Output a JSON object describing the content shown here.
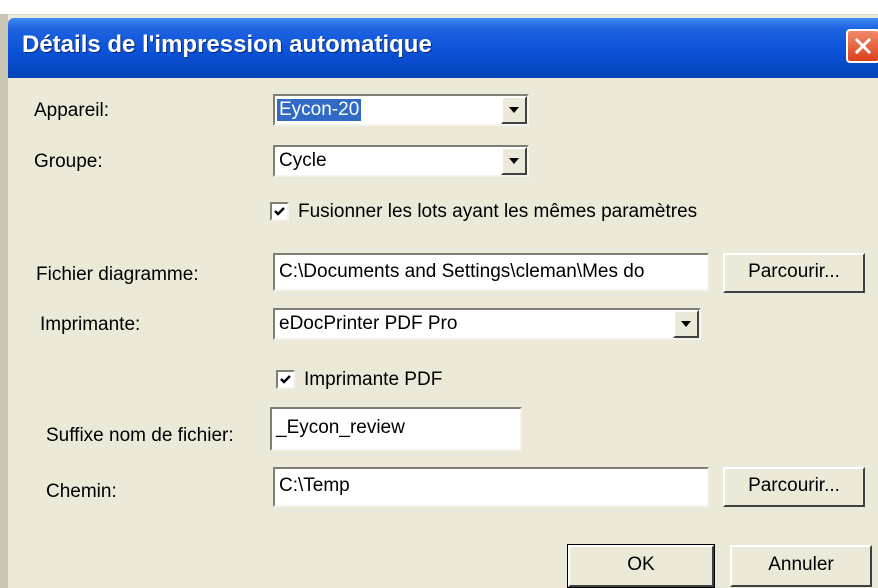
{
  "window": {
    "title": "Détails de l'impression automatique"
  },
  "form": {
    "appareil": {
      "label": "Appareil:",
      "value": "Eycon-20"
    },
    "groupe": {
      "label": "Groupe:",
      "value": "Cycle"
    },
    "fusionner": {
      "label": "Fusionner les lots ayant les mêmes paramètres",
      "checked": true
    },
    "fichier_diagramme": {
      "label": "Fichier diagramme:",
      "value": "C:\\Documents and Settings\\cleman\\Mes do",
      "browse_label": "Parcourir..."
    },
    "imprimante": {
      "label": "Imprimante:",
      "value": "eDocPrinter PDF Pro"
    },
    "imprimante_pdf": {
      "label": "Imprimante PDF",
      "checked": true
    },
    "suffixe": {
      "label": "Suffixe nom de fichier:",
      "value": "_Eycon_review"
    },
    "chemin": {
      "label": "Chemin:",
      "value": "C:\\Temp",
      "browse_label": "Parcourir..."
    }
  },
  "buttons": {
    "ok_label": "OK",
    "cancel_label": "Annuler"
  },
  "colors": {
    "titlebar": "#0a52d9",
    "dialog_bg": "#ece9d8",
    "selection": "#316ac5",
    "close_button": "#d9401c"
  },
  "icons": {
    "close": "close-icon",
    "dropdown": "chevron-down-icon",
    "check": "checkmark-icon"
  }
}
